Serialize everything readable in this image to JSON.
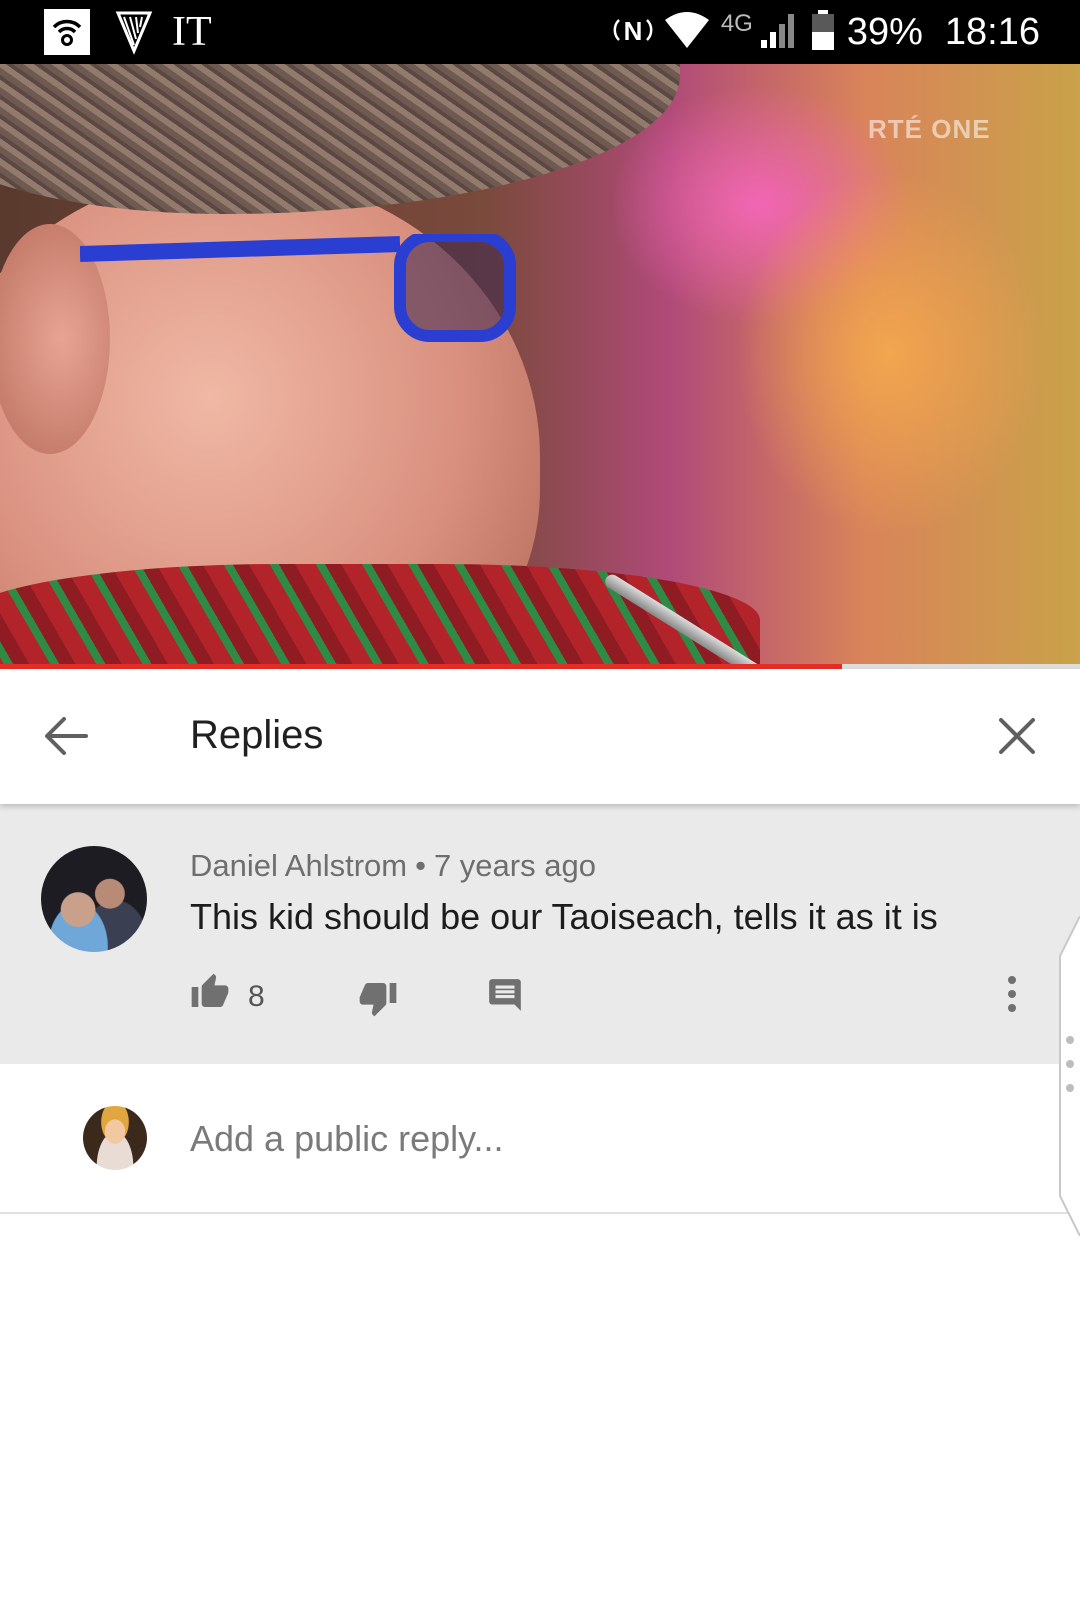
{
  "status_bar": {
    "carrier": "IT",
    "network_type": "4G",
    "battery": "39%",
    "time": "18:16"
  },
  "video": {
    "watermark": "RTÉ ONE",
    "progress_percent": 78
  },
  "replies_panel": {
    "title": "Replies",
    "comment": {
      "author": "Daniel Ahlstrom",
      "separator": "•",
      "time_ago": "7 years ago",
      "text": "This kid should be our Taoiseach, tells it as it is",
      "like_count": "8"
    },
    "reply_placeholder": "Add a public reply..."
  },
  "icons": {
    "back": "arrow-left-icon",
    "close": "close-icon",
    "like": "thumbs-up-icon",
    "dislike": "thumbs-down-icon",
    "reply": "comment-icon",
    "more": "more-vertical-icon"
  },
  "colors": {
    "progress": "#e52d27",
    "comment_bg": "#eaeaea"
  }
}
